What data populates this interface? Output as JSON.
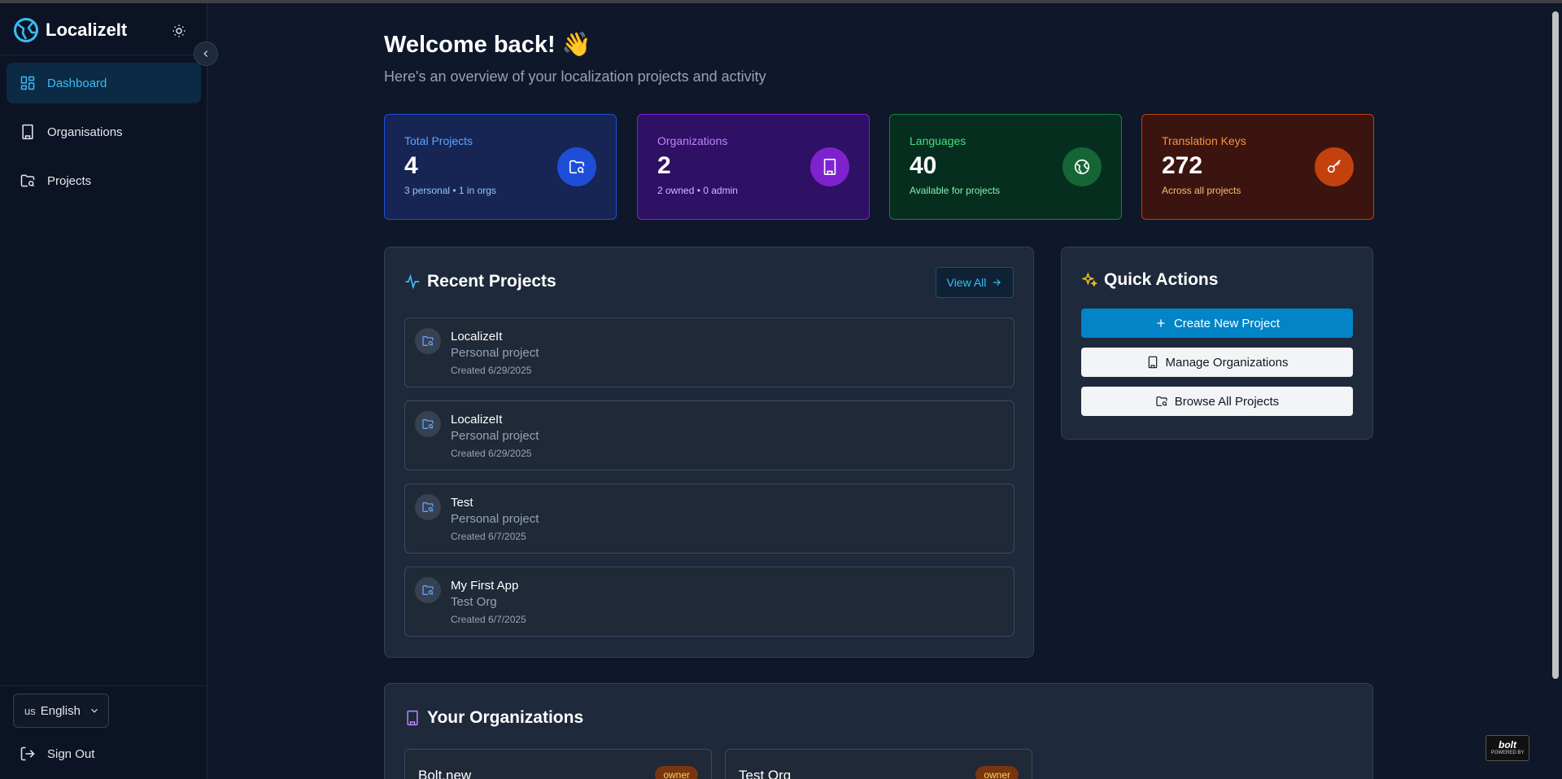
{
  "app": {
    "name": "LocalizeIt"
  },
  "sidebar": {
    "items": [
      {
        "label": "Dashboard",
        "icon": "dashboard-icon",
        "active": true
      },
      {
        "label": "Organisations",
        "icon": "building-icon",
        "active": false
      },
      {
        "label": "Projects",
        "icon": "folder-icon",
        "active": false
      }
    ],
    "language": {
      "flag": "us",
      "label": "English"
    },
    "sign_out": "Sign Out"
  },
  "header": {
    "title": "Welcome back! 👋",
    "subtitle": "Here's an overview of your localization projects and activity"
  },
  "stats": [
    {
      "title": "Total Projects",
      "value": "4",
      "sub": "3 personal • 1 in orgs",
      "color": "#60a5fa"
    },
    {
      "title": "Organizations",
      "value": "2",
      "sub": "2 owned • 0 admin",
      "color": "#c084fc"
    },
    {
      "title": "Languages",
      "value": "40",
      "sub": "Available for projects",
      "color": "#4ade80"
    },
    {
      "title": "Translation Keys",
      "value": "272",
      "sub": "Across all projects",
      "color": "#fb923c"
    }
  ],
  "recent_projects": {
    "title": "Recent Projects",
    "view_all": "View All",
    "items": [
      {
        "name": "LocalizeIt",
        "type": "Personal project",
        "created": "Created 6/29/2025"
      },
      {
        "name": "LocalizeIt",
        "type": "Personal project",
        "created": "Created 6/29/2025"
      },
      {
        "name": "Test",
        "type": "Personal project",
        "created": "Created 6/7/2025"
      },
      {
        "name": "My First App",
        "type": "Test Org",
        "created": "Created 6/7/2025"
      }
    ]
  },
  "quick_actions": {
    "title": "Quick Actions",
    "create": "Create New Project",
    "manage": "Manage Organizations",
    "browse": "Browse All Projects"
  },
  "organizations": {
    "title": "Your Organizations",
    "items": [
      {
        "name": "Bolt.new",
        "role": "owner"
      },
      {
        "name": "Test Org",
        "role": "owner"
      }
    ]
  },
  "badge": {
    "word": "bolt",
    "sub": "POWERED BY"
  }
}
